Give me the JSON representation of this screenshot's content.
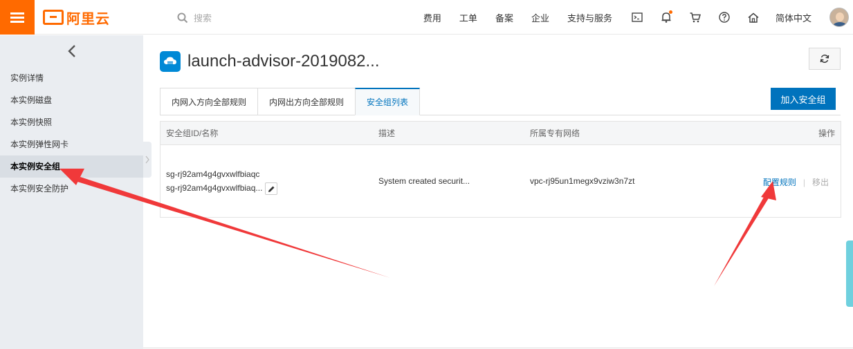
{
  "brand": {
    "name": "阿里云",
    "accent": "#ff6a00"
  },
  "search": {
    "placeholder": "搜索"
  },
  "nav": {
    "items": [
      "费用",
      "工单",
      "备案",
      "企业",
      "支持与服务"
    ],
    "language": "简体中文",
    "icons": [
      "terminal-icon",
      "bell-icon",
      "cart-icon",
      "help-icon",
      "home-icon"
    ]
  },
  "sidebar": {
    "items": [
      {
        "label": "实例详情"
      },
      {
        "label": "本实例磁盘"
      },
      {
        "label": "本实例快照"
      },
      {
        "label": "本实例弹性网卡"
      },
      {
        "label": "本实例安全组",
        "active": true
      },
      {
        "label": "本实例安全防护"
      }
    ]
  },
  "main": {
    "instance_title": "launch-advisor-2019082...",
    "tabs": [
      {
        "label": "内网入方向全部规则"
      },
      {
        "label": "内网出方向全部规则"
      },
      {
        "label": "安全组列表",
        "active": true
      }
    ],
    "add_button": "加入安全组",
    "table": {
      "headers": {
        "id_name": "安全组ID/名称",
        "desc": "描述",
        "vpc": "所属专有网络",
        "ops": "操作"
      },
      "rows": [
        {
          "id": "sg-rj92am4g4gvxwlfbiaqc",
          "name": "sg-rj92am4g4gvxwlfbiaq...",
          "desc": "System created securit...",
          "vpc": "vpc-rj95un1megx9vziw3n7zt",
          "action_config": "配置规则",
          "action_remove": "移出"
        }
      ]
    }
  },
  "colors": {
    "primary": "#0073bd",
    "annotation": "#f0393a"
  }
}
